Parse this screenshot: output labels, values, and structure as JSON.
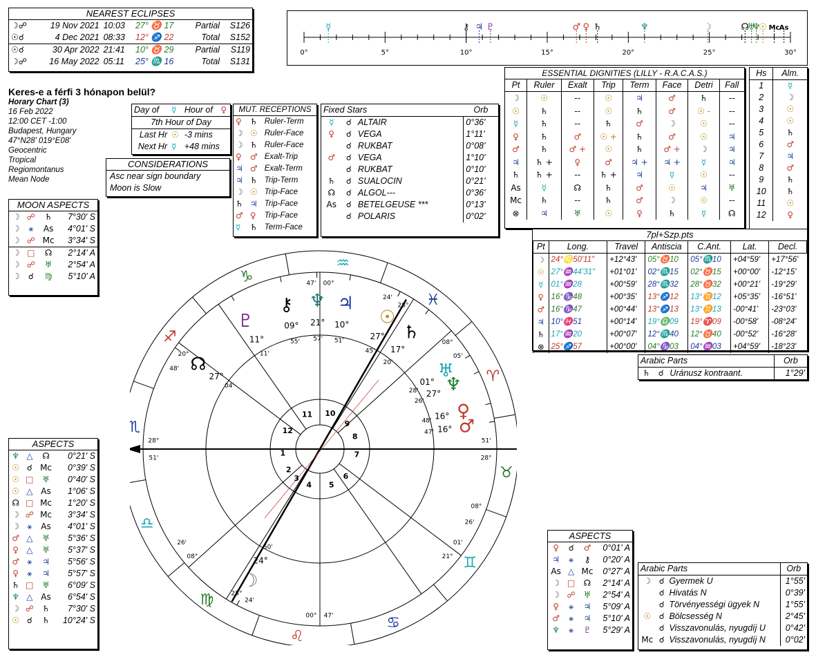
{
  "eclipses": {
    "title": "NEAREST ECLIPSES",
    "rows": [
      {
        "glyph": "☽☍",
        "date": "19 Nov 2021",
        "time": "10:03",
        "pos": "27° ♉ 17",
        "pos_color": "#2a7a2a",
        "kind": "Partial",
        "saros": "S126"
      },
      {
        "glyph": "☉☌",
        "date": "4 Dec 2021",
        "time": "08:33",
        "pos": "12° ♐ 22",
        "pos_color": "#c0392b",
        "kind": "Total",
        "saros": "S152"
      },
      {
        "glyph": "☉☌",
        "date": "30 Apr 2022",
        "time": "21:41",
        "pos": "10° ♉ 29",
        "pos_color": "#2a7a2a",
        "kind": "Partial",
        "saros": "S119"
      },
      {
        "glyph": "☽☍",
        "date": "16 May 2022",
        "time": "05:11",
        "pos": "25° ♏ 16",
        "pos_color": "#1a3a9a",
        "kind": "Total",
        "saros": "S131"
      }
    ]
  },
  "chart_info": {
    "title": "Keres-e a férfi 3 hónapon belül?",
    "lines": [
      "Horary Chart (3)",
      "16 Feb 2022",
      "12:00  CET -1:00",
      "Budapest, Hungary",
      "47°N28' 019°E08'",
      "Geocentric",
      "Tropical",
      "Regiomontanus",
      "Mean Node"
    ]
  },
  "day_hour": {
    "r1a": "Day of",
    "r1b": "☿",
    "r1c": "Hour of",
    "r1d": "♀",
    "r2": "7th Hour of Day",
    "r3a": "Last Hr",
    "r3b": "☉",
    "r3c": "-3 mins",
    "r4a": "Next Hr",
    "r4b": "☿",
    "r4c": "+48 mins"
  },
  "considerations": {
    "title": "CONSIDERATIONS",
    "lines": [
      "Asc near sign boundary",
      "Moon is Slow"
    ]
  },
  "mut_receptions": {
    "title": "MUT. RECEPTIONS",
    "rows": [
      [
        "♀",
        "♄",
        "Ruler-Term"
      ],
      [
        "☽",
        "☉",
        "Ruler-Face"
      ],
      [
        "☽",
        "♄",
        "Ruler-Face"
      ],
      [
        "♀",
        "♂",
        "Exalt-Trip"
      ],
      [
        "♃",
        "♂",
        "Exalt-Term"
      ],
      [
        "♃",
        "♄",
        "Trip-Term"
      ],
      [
        "☽",
        "☉",
        "Trip-Face"
      ],
      [
        "♄",
        "♃",
        "Trip-Face"
      ],
      [
        "♂",
        "♀",
        "Trip-Face"
      ],
      [
        "☿",
        "♄",
        "Term-Face"
      ]
    ]
  },
  "fixed_stars": {
    "title": "Fixed Stars",
    "orb": "Orb",
    "rows": [
      {
        "p": "☿",
        "a": "☌",
        "s": "ALTAIR",
        "o": "0°36'"
      },
      {
        "p": "♀",
        "a": "☌",
        "s": "VEGA",
        "o": "1°11'"
      },
      {
        "p": "",
        "a": "☌",
        "s": "RUKBAT",
        "o": "0°08'"
      },
      {
        "p": "♂",
        "a": "☌",
        "s": "VEGA",
        "o": "1°10'"
      },
      {
        "p": "",
        "a": "☌",
        "s": "RUKBAT",
        "o": "0°10'"
      },
      {
        "p": "♄",
        "a": "☌",
        "s": "SUALOCIN",
        "o": "0°21'"
      },
      {
        "p": "☊",
        "a": "☌",
        "s": "ALGOL---",
        "o": "0°36'"
      },
      {
        "p": "As",
        "a": "☌",
        "s": "BETELGEUSE ***",
        "o": "0°13'"
      },
      {
        "p": "",
        "a": "☌",
        "s": "POLARIS",
        "o": "0°02'"
      }
    ]
  },
  "moon_aspects": {
    "title": "MOON ASPECTS",
    "rows": [
      [
        "☽",
        "☍",
        "♄",
        "7°30' S"
      ],
      [
        "☽",
        "⚹",
        "As",
        "4°01' S"
      ],
      [
        "☽",
        "☍",
        "Mc",
        "3°34' S"
      ],
      [
        "☽",
        "□",
        "☊",
        "2°14' A"
      ],
      [
        "☽",
        "☍",
        "♅",
        "2°54' A"
      ],
      [
        "☽",
        "☌",
        "♍",
        "5°10' A"
      ]
    ]
  },
  "aspects_left": {
    "title": "ASPECTS",
    "rows": [
      [
        "♆",
        "△",
        "☊",
        "0°21' S"
      ],
      [
        "☉",
        "☌",
        "Mc",
        "0°39' S"
      ],
      [
        "☉",
        "□",
        "♅",
        "0°40' S"
      ],
      [
        "☉",
        "△",
        "As",
        "1°06' S"
      ],
      [
        "☊",
        "□",
        "Mc",
        "1°20' S"
      ],
      [
        "☽",
        "☍",
        "Mc",
        "3°34' S"
      ],
      [
        "☽",
        "⚹",
        "As",
        "4°01' S"
      ],
      [
        "♂",
        "△",
        "♅",
        "5°36' S"
      ],
      [
        "♀",
        "△",
        "♅",
        "5°37' S"
      ],
      [
        "♂",
        "⚹",
        "♃",
        "5°56' S"
      ],
      [
        "♀",
        "⚹",
        "♃",
        "5°57' S"
      ],
      [
        "♄",
        "□",
        "♅",
        "6°09' S"
      ],
      [
        "♆",
        "△",
        "As",
        "6°54' S"
      ],
      [
        "☽",
        "☍",
        "♄",
        "7°30' S"
      ],
      [
        "☉",
        "☌",
        "♄",
        "10°24' S"
      ]
    ]
  },
  "aspects_right": {
    "title": "ASPECTS",
    "rows": [
      [
        "♀",
        "☌",
        "♂",
        "0°01' A"
      ],
      [
        "♃",
        "⚹",
        "⚷",
        "0°20' A"
      ],
      [
        "As",
        "△",
        "Mc",
        "0°27' A"
      ],
      [
        "☽",
        "□",
        "☊",
        "2°14' A"
      ],
      [
        "☽",
        "☍",
        "♅",
        "2°54' A"
      ],
      [
        "♀",
        "⚹",
        "♃",
        "5°09' A"
      ],
      [
        "♂",
        "⚹",
        "♃",
        "5°10' A"
      ],
      [
        "♆",
        "⚹",
        "♇",
        "5°29' A"
      ]
    ]
  },
  "dignities": {
    "title": "ESSENTIAL DIGNITIES (LILLY - R.A.C.A.S.)",
    "headers": [
      "Pt",
      "Ruler",
      "Exalt",
      "Trip",
      "Term",
      "Face",
      "Detri",
      "Fall"
    ],
    "rows": [
      [
        "☽",
        "☉",
        "--",
        "☉",
        "♃",
        "♂",
        "♄",
        "--"
      ],
      [
        "☉",
        "♄",
        "--",
        "☉",
        "♄",
        "♂",
        "☉ -",
        "--"
      ],
      [
        "☿",
        "♄",
        "--",
        "♄",
        "♂",
        "☽",
        "☉",
        "--"
      ],
      [
        "♀",
        "♄",
        "♂",
        "☉ +",
        "♄",
        "♂",
        "☉",
        "♃"
      ],
      [
        "♂",
        "♄",
        "♂ +",
        "☉",
        "♄",
        "♂ +",
        "☽",
        "♃"
      ],
      [
        "♃",
        "♄ +",
        "♀",
        "♂",
        "♃ +",
        "♃ +",
        "☿",
        "♃"
      ],
      [
        "♄",
        "♄ +",
        "--",
        "♄ +",
        "♃",
        "☿",
        "☉",
        "--"
      ],
      [
        "As",
        "☿",
        "☊",
        "♄",
        "♂",
        "☉",
        "♃",
        "♅"
      ],
      [
        "Mc",
        "♄",
        "--",
        "♄",
        "♂",
        "☽",
        "☉",
        "--"
      ],
      [
        "⊗",
        "♃",
        "♅",
        "☉",
        "♀",
        "♄",
        "☿",
        "☊"
      ]
    ]
  },
  "houses": {
    "h1": "Hs",
    "h2": "Alm.",
    "rows": [
      [
        "1",
        "☿"
      ],
      [
        "2",
        "☽"
      ],
      [
        "3",
        "☉"
      ],
      [
        "4",
        "☉"
      ],
      [
        "5",
        "♄"
      ],
      [
        "6",
        "♂"
      ],
      [
        "7",
        "♃"
      ],
      [
        "8",
        "♂"
      ],
      [
        "9",
        "♄"
      ],
      [
        "10",
        "♄"
      ],
      [
        "11",
        "☉"
      ],
      [
        "12",
        "♀"
      ]
    ]
  },
  "positions": {
    "title": "7pl+Szp.pts",
    "headers": [
      "Pt",
      "Long.",
      "Travel",
      "Antiscia",
      "C.Ant.",
      "Lat.",
      "Decl."
    ],
    "rows": [
      {
        "pt": "☽",
        "long": "24°♌50'11\"",
        "lc": "#c0392b",
        "travel": "+12°43'",
        "ant": "05°♉10",
        "ac": "#2a7a2a",
        "cant": "05°♏10",
        "cc": "#1a3a9a",
        "lat": "+04°59'",
        "decl": "+17°56'"
      },
      {
        "pt": "☉",
        "long": "27°♒44'31\"",
        "lc": "#1aa7b5",
        "travel": "+01°01'",
        "ant": "02°♏15",
        "ac": "#1a3a9a",
        "cant": "02°♉15",
        "cc": "#2a7a2a",
        "lat": "+00°00'",
        "decl": "-12°15'"
      },
      {
        "pt": "☿",
        "long": "01°♒28",
        "lc": "#1aa7b5",
        "travel": "+00°59'",
        "ant": "28°♏32",
        "ac": "#1a3a9a",
        "cant": "28°♉32",
        "cc": "#2a7a2a",
        "lat": "+00°21'",
        "decl": "-19°29'"
      },
      {
        "pt": "♀",
        "long": "16°♑48",
        "lc": "#2a7a2a",
        "travel": "+00°35'",
        "ant": "13°♐12",
        "ac": "#c0392b",
        "cant": "13°♊12",
        "cc": "#1aa7b5",
        "lat": "+05°35'",
        "decl": "-16°51'"
      },
      {
        "pt": "♂",
        "long": "16°♑47",
        "lc": "#2a7a2a",
        "travel": "+00°44'",
        "ant": "13°♐13",
        "ac": "#c0392b",
        "cant": "13°♊13",
        "cc": "#1aa7b5",
        "lat": "-00°41'",
        "decl": "-23°03'"
      },
      {
        "pt": "♃",
        "long": "10°♓51",
        "lc": "#1a3a9a",
        "travel": "+00°14'",
        "ant": "19°♎09",
        "ac": "#1aa7b5",
        "cant": "19°♈09",
        "cc": "#c0392b",
        "lat": "-00°58'",
        "decl": "-08°24'"
      },
      {
        "pt": "♄",
        "long": "17°♒20",
        "lc": "#1aa7b5",
        "travel": "+00°07'",
        "ant": "12°♏40",
        "ac": "#1a3a9a",
        "cant": "12°♉40",
        "cc": "#2a7a2a",
        "lat": "-00°52'",
        "decl": "-16°28'"
      },
      {
        "pt": "⊗",
        "long": "25°♐57",
        "lc": "#c0392b",
        "travel": "+00°00'",
        "ant": "04°♑03",
        "ac": "#2a7a2a",
        "cant": "04°♒03",
        "cc": "#1a3a9a",
        "lat": "+04°59'",
        "decl": "-18°23'"
      }
    ]
  },
  "arabic1": {
    "title": "Arabic Parts",
    "orb": "Orb",
    "rows": [
      [
        "♄",
        "☌",
        "Uránusz kontraant.",
        "1°29'"
      ]
    ]
  },
  "arabic2": {
    "title": "Arabic Parts",
    "orb": "Orb",
    "rows": [
      [
        "☽",
        "☌",
        "Gyermek U",
        "1°55'"
      ],
      [
        "",
        "☌",
        "Hivatás N",
        "0°39'"
      ],
      [
        "",
        "☌",
        "Törvényességi ügyek N",
        "1°55'"
      ],
      [
        "☉",
        "☌",
        "Bölcsesség N",
        "2°45'"
      ],
      [
        "",
        "☌",
        "Visszavonulás, nyugdíj U",
        "0°42'"
      ],
      [
        "Mc",
        "☌",
        "Visszavonulás, nyugdíj N",
        "0°02'"
      ]
    ]
  },
  "ruler": {
    "labels": [
      "0°",
      "5°",
      "10°",
      "15°",
      "20°",
      "25°",
      "30°"
    ],
    "glyphs": [
      {
        "g": "☿",
        "d": 1.5,
        "c": "#1aa7b5"
      },
      {
        "g": "⚷",
        "d": 10.0,
        "c": "#000"
      },
      {
        "g": "♃",
        "d": 10.8,
        "c": "#1a3a9a"
      },
      {
        "g": "♇",
        "d": 11.5,
        "c": "#7a2a8a"
      },
      {
        "g": "♂",
        "d": 16.8,
        "c": "#c0392b"
      },
      {
        "g": "♀",
        "d": 17.4,
        "c": "#c0392b"
      },
      {
        "g": "♄",
        "d": 18.1,
        "c": "#000"
      },
      {
        "g": "♆",
        "d": 21.0,
        "c": "#1a7a7a"
      },
      {
        "g": "☽",
        "d": 24.9,
        "c": "#777"
      },
      {
        "g": "☊",
        "d": 27.2,
        "c": "#000"
      },
      {
        "g": "♅",
        "d": 27.6,
        "c": "#1a7a2a"
      },
      {
        "g": "♆",
        "d": 27.9,
        "c": "#1a7a2a"
      },
      {
        "g": "☉",
        "d": 28.3,
        "c": "#b8860b"
      },
      {
        "g": "Mc",
        "d": 29.0,
        "c": "#000"
      },
      {
        "g": "As",
        "d": 29.6,
        "c": "#000"
      }
    ]
  },
  "wheel": {
    "signs": [
      {
        "g": "♈",
        "c": "#c0392b",
        "a": 25
      },
      {
        "g": "♓",
        "c": "#1a3a9a",
        "a": 55
      },
      {
        "g": "♒",
        "c": "#1aa7b5",
        "a": 85
      },
      {
        "g": "♑",
        "c": "#2a7a2a",
        "a": 115
      },
      {
        "g": "♐",
        "c": "#c0392b",
        "a": 145
      },
      {
        "g": "♏",
        "c": "#1a3a9a",
        "a": 175
      },
      {
        "g": "♎",
        "c": "#1aa7b5",
        "a": 205
      },
      {
        "g": "♍",
        "c": "#2a7a2a",
        "a": 235
      },
      {
        "g": "♌",
        "c": "#c0392b",
        "a": 265
      },
      {
        "g": "♋",
        "c": "#1a3a9a",
        "a": 295
      },
      {
        "g": "♊",
        "c": "#1aa7b5",
        "a": 325
      },
      {
        "g": "♉",
        "c": "#2a7a2a",
        "a": 355
      }
    ],
    "house_numbers": [
      "1",
      "2",
      "3",
      "4",
      "5",
      "6",
      "7",
      "8",
      "9",
      "10",
      "11",
      "12"
    ],
    "cusp_labels": [
      {
        "t": "28°",
        "a": -3
      },
      {
        "t": "51'",
        "a": 3
      },
      {
        "t": "28°",
        "a": 177
      },
      {
        "t": "51'",
        "a": 183
      },
      {
        "t": "00°",
        "a": 87
      },
      {
        "t": "47'",
        "a": 93
      },
      {
        "t": "00°",
        "a": 267
      },
      {
        "t": "47'",
        "a": 273
      },
      {
        "t": "20°",
        "a": 145
      },
      {
        "t": "48'",
        "a": 151
      },
      {
        "t": "08°",
        "a": 40
      },
      {
        "t": "05'",
        "a": 34
      },
      {
        "t": "21°",
        "a": -40
      },
      {
        "t": "01'",
        "a": -34
      },
      {
        "t": "08°",
        "a": -140
      },
      {
        "t": "26'",
        "a": -146
      },
      {
        "t": "28°",
        "a": -120
      },
      {
        "t": "24'",
        "a": -115
      },
      {
        "t": "28°",
        "a": 60
      },
      {
        "t": "24'",
        "a": 66
      },
      {
        "t": "26'",
        "a": -26
      },
      {
        "t": "08°",
        "a": -20
      }
    ],
    "planets": [
      {
        "g": "⚷",
        "c": "#000",
        "deg": "09°",
        "min": "55'",
        "a": 103
      },
      {
        "g": "♆",
        "c": "#1a7a7a",
        "deg": "21°",
        "min": "57'",
        "a": 91
      },
      {
        "g": "♃",
        "c": "#1a3a9a",
        "deg": "10°",
        "min": "51'",
        "a": 80
      },
      {
        "g": "♇",
        "c": "#7a2a8a",
        "deg": "11°",
        "min": "11'",
        "a": 120
      },
      {
        "g": "☊",
        "c": "#000",
        "deg": "27°",
        "min": "04'",
        "a": 145
      },
      {
        "g": "☉",
        "c": "#b8860b",
        "deg": "27°",
        "min": "45'",
        "a": 63
      },
      {
        "g": "♄",
        "c": "#000",
        "deg": "17°",
        "min": "20'",
        "a": 52
      },
      {
        "g": "♅",
        "c": "#1aa7b5",
        "deg": "01°",
        "min": "28'",
        "a": 32
      },
      {
        "g": "♆",
        "c": "#1a7a2a",
        "deg": "27°",
        "min": "26'",
        "a": 26
      },
      {
        "g": "♀",
        "c": "#c0392b",
        "deg": "16°",
        "min": "48'",
        "a": 15
      },
      {
        "g": "♂",
        "c": "#c0392b",
        "deg": "16°",
        "min": "47'",
        "a": 9
      },
      {
        "g": "☽",
        "c": "#777",
        "deg": "24°",
        "min": "50'",
        "a": -118
      }
    ]
  }
}
